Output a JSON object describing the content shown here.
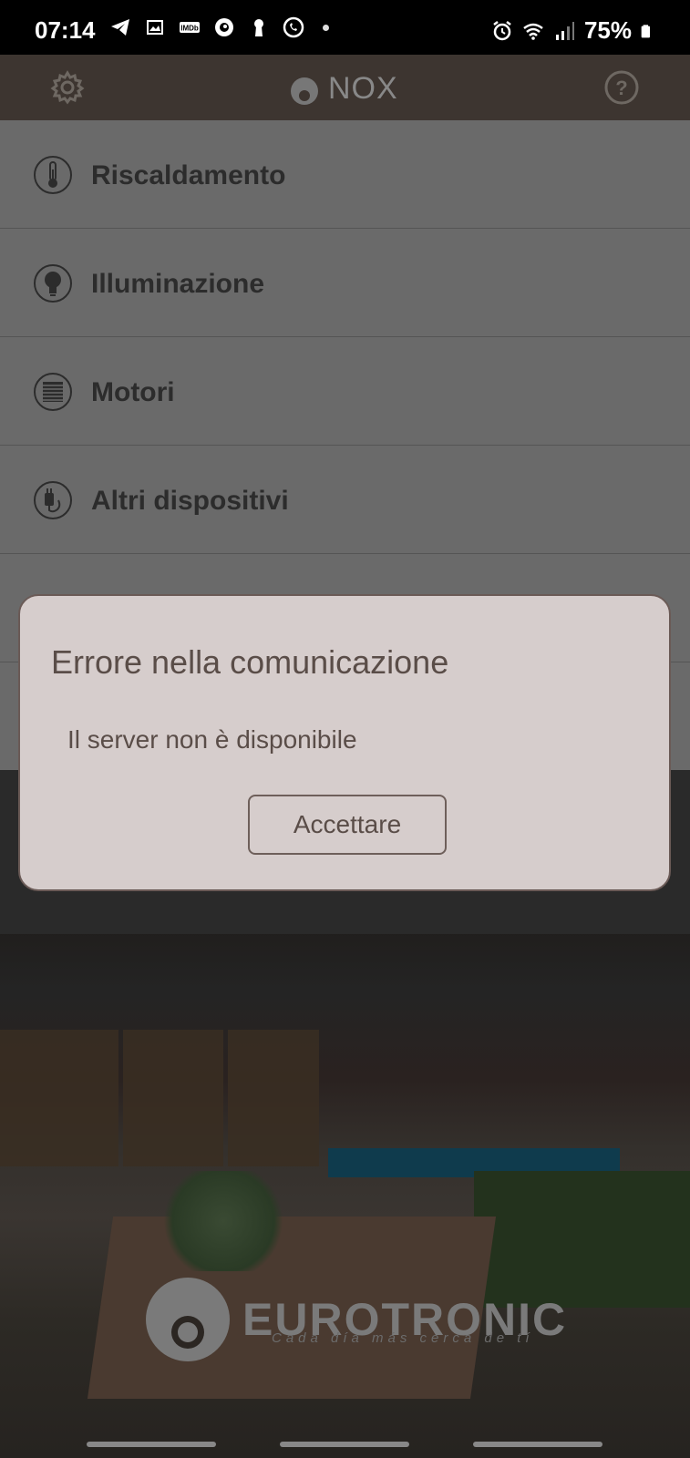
{
  "status_bar": {
    "time": "07:14",
    "battery": "75%",
    "icons_left": [
      "telegram-icon",
      "image-icon",
      "imdb-icon",
      "app-icon",
      "keyhole-icon",
      "whatsapp-icon"
    ],
    "icons_right": [
      "alarm-icon",
      "wifi-icon",
      "signal-icon",
      "battery-icon"
    ]
  },
  "header": {
    "app_name": "NOX",
    "settings_icon": "gear-icon",
    "help_icon": "help-icon"
  },
  "menu": {
    "items": [
      {
        "label": "Riscaldamento",
        "icon": "thermometer-icon"
      },
      {
        "label": "Illuminazione",
        "icon": "lightbulb-icon"
      },
      {
        "label": "Motori",
        "icon": "blinds-icon"
      },
      {
        "label": "Altri dispositivi",
        "icon": "plug-icon"
      }
    ]
  },
  "background": {
    "brand_name": "EUROTRONIC",
    "brand_tagline": "Cada día más cerca de tí"
  },
  "dialog": {
    "title": "Errore nella comunicazione",
    "message": "Il server non è disponibile",
    "button_label": "Accettare"
  },
  "colors": {
    "header_bg": "#3d3530",
    "dialog_bg": "#d6cdcc",
    "dialog_text": "#5a4d48"
  }
}
